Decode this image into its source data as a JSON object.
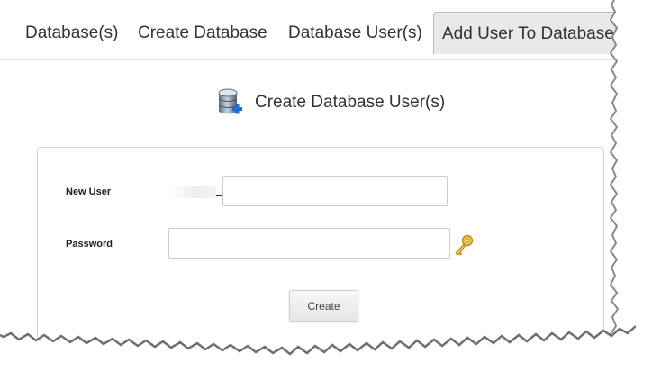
{
  "tabs": [
    {
      "label": "Database(s)"
    },
    {
      "label": "Create Database"
    },
    {
      "label": "Database User(s)"
    },
    {
      "label": "Add User To Database"
    }
  ],
  "heading": {
    "title": "Create Database User(s)",
    "icon": "database-add-icon"
  },
  "form": {
    "new_user_label": "New User",
    "new_user_value": "",
    "password_label": "Password",
    "password_value": "",
    "generate_password_icon": "key-icon",
    "create_label": "Create"
  },
  "colors": {
    "active_tab_bg": "#e9e9e9",
    "text": "#333333",
    "border": "#d6d6d6"
  }
}
